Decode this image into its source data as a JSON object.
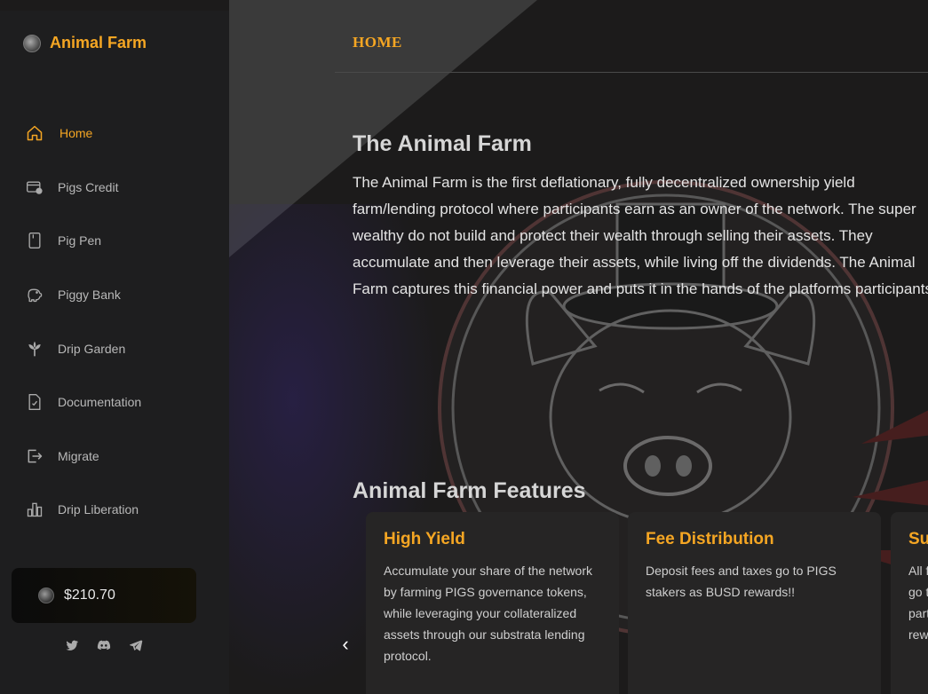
{
  "app": {
    "name": "Animal Farm"
  },
  "header": {
    "crumb": "HOME"
  },
  "sidebar": {
    "items": [
      {
        "label": "Home",
        "icon": "home-icon",
        "active": true
      },
      {
        "label": "Pigs Credit",
        "icon": "credit-card-icon"
      },
      {
        "label": "Pig Pen",
        "icon": "pen-icon"
      },
      {
        "label": "Piggy Bank",
        "icon": "piggy-bank-icon"
      },
      {
        "label": "Drip Garden",
        "icon": "sprout-icon"
      },
      {
        "label": "Documentation",
        "icon": "document-icon"
      },
      {
        "label": "Migrate",
        "icon": "migrate-icon"
      },
      {
        "label": "Drip Liberation",
        "icon": "bar-chart-icon"
      }
    ],
    "price": "$210.70",
    "socials": [
      "twitter-icon",
      "discord-icon",
      "telegram-icon"
    ]
  },
  "main": {
    "title": "The Animal Farm",
    "intro": "The Animal Farm is the first deflationary, fully decentralized ownership yield farm/lending protocol where participants earn as an owner of the network. The super wealthy do not build and protect their wealth through selling their assets. They accumulate and then leverage their assets, while living off the dividends. The Animal Farm captures this financial power and puts it in the hands of the platforms participants.",
    "features_title": "Animal Farm Features",
    "prev_arrow": "‹",
    "cards": [
      {
        "title": "High Yield",
        "text": "Accumulate your share of the network by farming PIGS governance tokens, while leveraging your collateralized assets through our substrata lending protocol."
      },
      {
        "title": "Fee Distribution",
        "text": "Deposit fees and taxes go to PIGS stakers as BUSD rewards!!"
      },
      {
        "title": "Su",
        "text": "All f go t parti rew"
      }
    ]
  },
  "colors": {
    "accent": "#f5a623",
    "background": "#1c1b1b",
    "sidebar": "#1e1e1f",
    "card": "#262525"
  }
}
